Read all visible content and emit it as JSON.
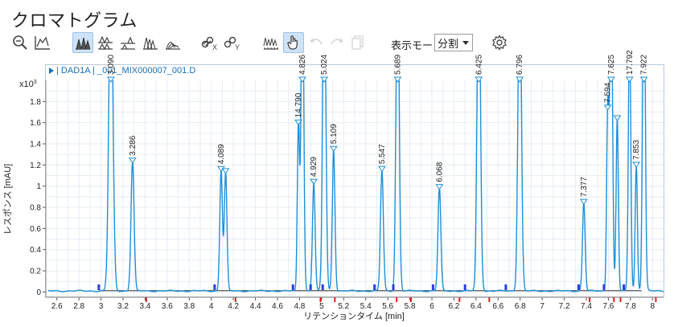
{
  "app": {
    "title": "クロマトグラム"
  },
  "toolbar": {
    "mode_label": "表示モード",
    "mode_value": "分割",
    "buttons": [
      {
        "name": "zoom-icon",
        "active": false
      },
      {
        "name": "autoscale-icon",
        "active": false
      },
      {
        "name": "overlay-icon",
        "active": true
      },
      {
        "name": "stack-icon",
        "active": false
      },
      {
        "name": "separate-icon",
        "active": false
      },
      {
        "name": "offset-icon",
        "active": false
      },
      {
        "name": "normalize-icon",
        "active": false
      },
      {
        "name": "link-x-icon",
        "active": false
      },
      {
        "name": "link-y-icon",
        "active": false
      },
      {
        "name": "integrate-icon",
        "active": false
      },
      {
        "name": "pan-hand-icon",
        "active": true
      },
      {
        "name": "undo-icon",
        "active": false
      },
      {
        "name": "redo-icon",
        "active": false
      },
      {
        "name": "copy-icon",
        "active": false
      },
      {
        "name": "settings-icon",
        "active": false
      }
    ]
  },
  "trace": {
    "label": "| DAD1A | _001_MIX000007_001.D"
  },
  "chart_data": {
    "type": "line",
    "title": "",
    "xlabel": "リテンションタイム [min]",
    "ylabel": "レスポンス [mAU]",
    "y_multiplier": "x10",
    "y_multiplier_exp": "3",
    "xlim": [
      2.5,
      8.1
    ],
    "ylim": [
      -0.05,
      2.0
    ],
    "x_ticks": [
      2.6,
      2.8,
      3,
      3.2,
      3.4,
      3.6,
      3.8,
      4,
      4.2,
      4.4,
      4.6,
      4.8,
      5,
      5.2,
      5.4,
      5.6,
      5.8,
      6,
      6.2,
      6.4,
      6.6,
      6.8,
      7,
      7.2,
      7.4,
      7.6,
      7.8,
      8
    ],
    "x_tick_labels": [
      "2.6",
      "2.8",
      "3",
      "3.2",
      "3.4",
      "3.6",
      "3.8",
      "4",
      "4.2",
      "4.4",
      "4.6",
      "4.8",
      "5",
      "5.2",
      "5.4",
      "5.6",
      "5.8",
      "6",
      "6.2",
      "6.4",
      "6.6",
      "6.8",
      "7",
      "7.2",
      "7.4",
      "7.6",
      "7.8",
      "8"
    ],
    "y_ticks": [
      0,
      0.2,
      0.4,
      0.6,
      0.8,
      1,
      1.2,
      1.4,
      1.6,
      1.8
    ],
    "y_tick_labels": [
      "0",
      "0.2",
      "0.4",
      "0.6",
      "0.8",
      "1",
      "1.2",
      "1.4",
      "1.6",
      "1.8"
    ],
    "grid": true,
    "line_color": "#1f8fd6",
    "baseline_color": "#111111",
    "start_marker_color": "#2a3de0",
    "end_marker_color": "#e02020",
    "peaks": [
      {
        "rt": 3.09,
        "label": "3.090",
        "height": 3.2,
        "width": 0.018
      },
      {
        "rt": 3.286,
        "label": "3.286",
        "height": 1.22,
        "width": 0.014
      },
      {
        "rt": 4.089,
        "label": "4.089",
        "height": 1.14,
        "width": 0.012
      },
      {
        "rt": 4.13,
        "label": "",
        "height": 1.12,
        "width": 0.012
      },
      {
        "rt": 4.79,
        "label": "14.790",
        "height": 1.58,
        "width": 0.01
      },
      {
        "rt": 4.826,
        "label": "4.826",
        "height": 3.2,
        "width": 0.012
      },
      {
        "rt": 4.929,
        "label": "4.929",
        "height": 1.02,
        "width": 0.012
      },
      {
        "rt": 5.024,
        "label": "5.024",
        "height": 3.2,
        "width": 0.014
      },
      {
        "rt": 5.109,
        "label": "5.109",
        "height": 1.33,
        "width": 0.012
      },
      {
        "rt": 5.547,
        "label": "5.547",
        "height": 1.14,
        "width": 0.013
      },
      {
        "rt": 5.689,
        "label": "5.689",
        "height": 3.2,
        "width": 0.014
      },
      {
        "rt": 6.068,
        "label": "6.068",
        "height": 0.97,
        "width": 0.013
      },
      {
        "rt": 6.425,
        "label": "6.425",
        "height": 3.2,
        "width": 0.015
      },
      {
        "rt": 6.796,
        "label": "6.796",
        "height": 3.2,
        "width": 0.015
      },
      {
        "rt": 7.377,
        "label": "7.377",
        "height": 0.83,
        "width": 0.012
      },
      {
        "rt": 7.594,
        "label": "7.594",
        "height": 1.72,
        "width": 0.01
      },
      {
        "rt": 7.625,
        "label": "7.625",
        "height": 3.2,
        "width": 0.012
      },
      {
        "rt": 7.68,
        "label": "",
        "height": 1.62,
        "width": 0.01
      },
      {
        "rt": 7.792,
        "label": "17.792",
        "height": 2.52,
        "width": 0.011
      },
      {
        "rt": 7.853,
        "label": "7.853",
        "height": 1.18,
        "width": 0.01
      },
      {
        "rt": 7.922,
        "label": "7.922",
        "height": 3.2,
        "width": 0.012
      }
    ],
    "peak_starts": [
      2.98,
      4.03,
      4.74,
      4.9,
      5.01,
      5.48,
      5.65,
      6.01,
      6.3,
      6.67,
      7.33,
      7.56,
      7.74
    ],
    "peak_ends": [
      3.41,
      4.22,
      4.99,
      5.12,
      5.68,
      5.81,
      6.25,
      6.52,
      7.43,
      7.65,
      7.71,
      8.03
    ]
  }
}
